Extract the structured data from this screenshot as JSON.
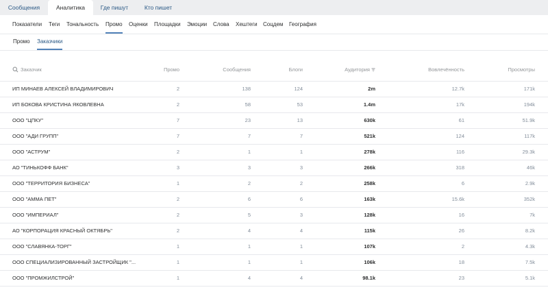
{
  "top_tabs": [
    "Сообщения",
    "Аналитика",
    "Где пишут",
    "Кто пишет"
  ],
  "subnav": [
    "Показатели",
    "Теги",
    "Тональность",
    "Промо",
    "Оценки",
    "Площадки",
    "Эмоции",
    "Слова",
    "Хештеги",
    "Соцдем",
    "География"
  ],
  "subnav2": [
    "Промо",
    "Заказчики"
  ],
  "table": {
    "headers": {
      "name": "Заказчик",
      "promo": "Промо",
      "messages": "Сообщения",
      "blogs": "Блоги",
      "audience": "Аудитория",
      "engagement": "Вовлечённость",
      "views": "Просмотры"
    },
    "rows": [
      {
        "name": "ИП МИНАЕВ АЛЕКСЕЙ ВЛАДИМИРОВИЧ",
        "promo": "2",
        "messages": "138",
        "blogs": "124",
        "audience": "2m",
        "engagement": "12.7k",
        "views": "171k"
      },
      {
        "name": "ИП БОКОВА КРИСТИНА ЯКОВЛЕВНА",
        "promo": "2",
        "messages": "58",
        "blogs": "53",
        "audience": "1.4m",
        "engagement": "17k",
        "views": "194k"
      },
      {
        "name": "ООО \"ЦПКУ\"",
        "promo": "7",
        "messages": "23",
        "blogs": "13",
        "audience": "630k",
        "engagement": "61",
        "views": "51.9k"
      },
      {
        "name": "ООО \"АДИ ГРУПП\"",
        "promo": "7",
        "messages": "7",
        "blogs": "7",
        "audience": "521k",
        "engagement": "124",
        "views": "117k"
      },
      {
        "name": "ООО \"АСТРУМ\"",
        "promo": "2",
        "messages": "1",
        "blogs": "1",
        "audience": "278k",
        "engagement": "116",
        "views": "29.3k"
      },
      {
        "name": "АО \"ТИНЬКОФФ БАНК\"",
        "promo": "3",
        "messages": "3",
        "blogs": "3",
        "audience": "266k",
        "engagement": "318",
        "views": "46k"
      },
      {
        "name": "ООО \"ТЕРРИТОРИЯ БИЗНЕСА\"",
        "promo": "1",
        "messages": "2",
        "blogs": "2",
        "audience": "258k",
        "engagement": "6",
        "views": "2.9k"
      },
      {
        "name": "ООО \"АММА ПЕТ\"",
        "promo": "2",
        "messages": "6",
        "blogs": "6",
        "audience": "163k",
        "engagement": "15.6k",
        "views": "352k"
      },
      {
        "name": "ООО \"ИМПЕРИАЛ\"",
        "promo": "2",
        "messages": "5",
        "blogs": "3",
        "audience": "128k",
        "engagement": "16",
        "views": "7k"
      },
      {
        "name": "АО \"КОРПОРАЦИЯ КРАСНЫЙ ОКТЯБРЬ\"",
        "promo": "2",
        "messages": "4",
        "blogs": "4",
        "audience": "115k",
        "engagement": "26",
        "views": "8.2k"
      },
      {
        "name": "ООО \"СЛАВЯНКА-ТОРГ\"",
        "promo": "1",
        "messages": "1",
        "blogs": "1",
        "audience": "107k",
        "engagement": "2",
        "views": "4.3k"
      },
      {
        "name": "ООО СПЕЦИАЛИЗИРОВАННЫЙ ЗАСТРОЙЩИК \"...",
        "promo": "1",
        "messages": "1",
        "blogs": "1",
        "audience": "106k",
        "engagement": "18",
        "views": "7.5k"
      },
      {
        "name": "ООО \"ПРОМЖИЛСТРОЙ\"",
        "promo": "1",
        "messages": "4",
        "blogs": "4",
        "audience": "98.1k",
        "engagement": "23",
        "views": "5.1k"
      }
    ]
  },
  "colors": {
    "accent": "#5181b8",
    "link": "#2a5885",
    "muted": "#939699",
    "bg": "#edeef0"
  }
}
